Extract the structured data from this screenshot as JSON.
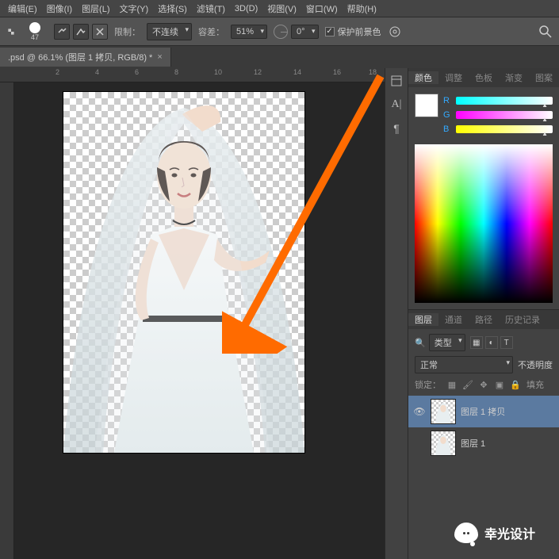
{
  "menu": {
    "edit": "编辑(E)",
    "image": "图像(I)",
    "layer": "图层(L)",
    "type": "文字(Y)",
    "select": "选择(S)",
    "filter": "滤镜(T)",
    "threed": "3D(D)",
    "view": "视图(V)",
    "window": "窗口(W)",
    "help": "帮助(H)"
  },
  "toolbar": {
    "brush_size": "47",
    "limit_label": "限制：",
    "limit_value": "不连续",
    "tolerance_label": "容差：",
    "tolerance_value": "51%",
    "angle_value": "0°",
    "protect_fg": "保护前景色"
  },
  "doc_tab": ".psd @ 66.1% (图层 1 拷贝, RGB/8) *",
  "ruler": {
    "r1": "2",
    "r2": "4",
    "r3": "6",
    "r4": "8",
    "r5": "10",
    "r6": "12",
    "r7": "14",
    "r8": "16",
    "r9": "18"
  },
  "color_panel": {
    "tab_color": "颜色",
    "tab_adjust": "调整",
    "tab_swatch": "色板",
    "tab_gradient": "渐变",
    "tab_pattern": "图案",
    "r": "R",
    "g": "G",
    "b": "B"
  },
  "layers_panel": {
    "tab_layers": "图层",
    "tab_channels": "通道",
    "tab_paths": "路径",
    "tab_history": "历史记录",
    "kind_label": "类型",
    "blend_mode": "正常",
    "opacity_label": "不透明度",
    "lock_label": "锁定：",
    "fill_label": "填充",
    "layer1": "图层 1 拷贝",
    "layer2": "图层 1"
  },
  "watermark": "幸光设计"
}
